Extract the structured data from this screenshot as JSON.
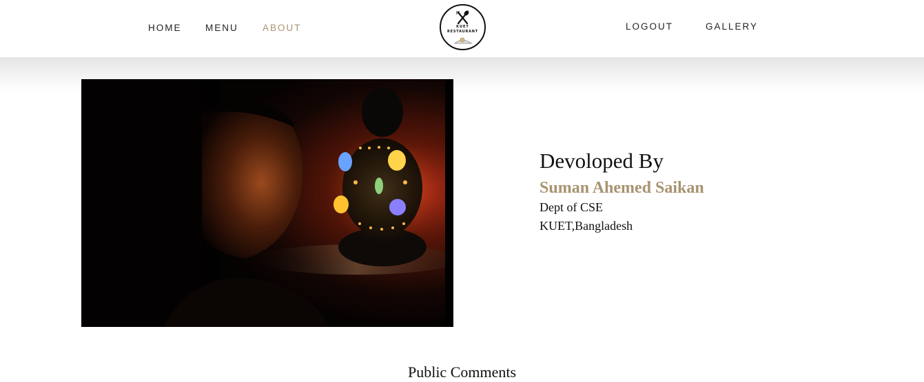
{
  "nav": {
    "links_left": [
      {
        "label": "HOME",
        "active": false
      },
      {
        "label": "MENU",
        "active": false
      },
      {
        "label": "ABOUT",
        "active": true
      }
    ],
    "links_right": [
      {
        "label": "LOGOUT"
      },
      {
        "label": "GALLERY"
      }
    ],
    "logo": {
      "line1": "KUET",
      "line2": "RESTAURANT",
      "icon": "fork-spoon-icon"
    }
  },
  "about": {
    "photo_alt": "developer-photo",
    "heading": "Devoloped By",
    "name": "Suman Ahemed Saikan",
    "dept": "Dept of CSE",
    "institution": "KUET,Bangladesh"
  },
  "comments": {
    "title": "Public Comments"
  },
  "colors": {
    "accent": "#a89370",
    "text": "#111111",
    "background": "#ffffff"
  }
}
